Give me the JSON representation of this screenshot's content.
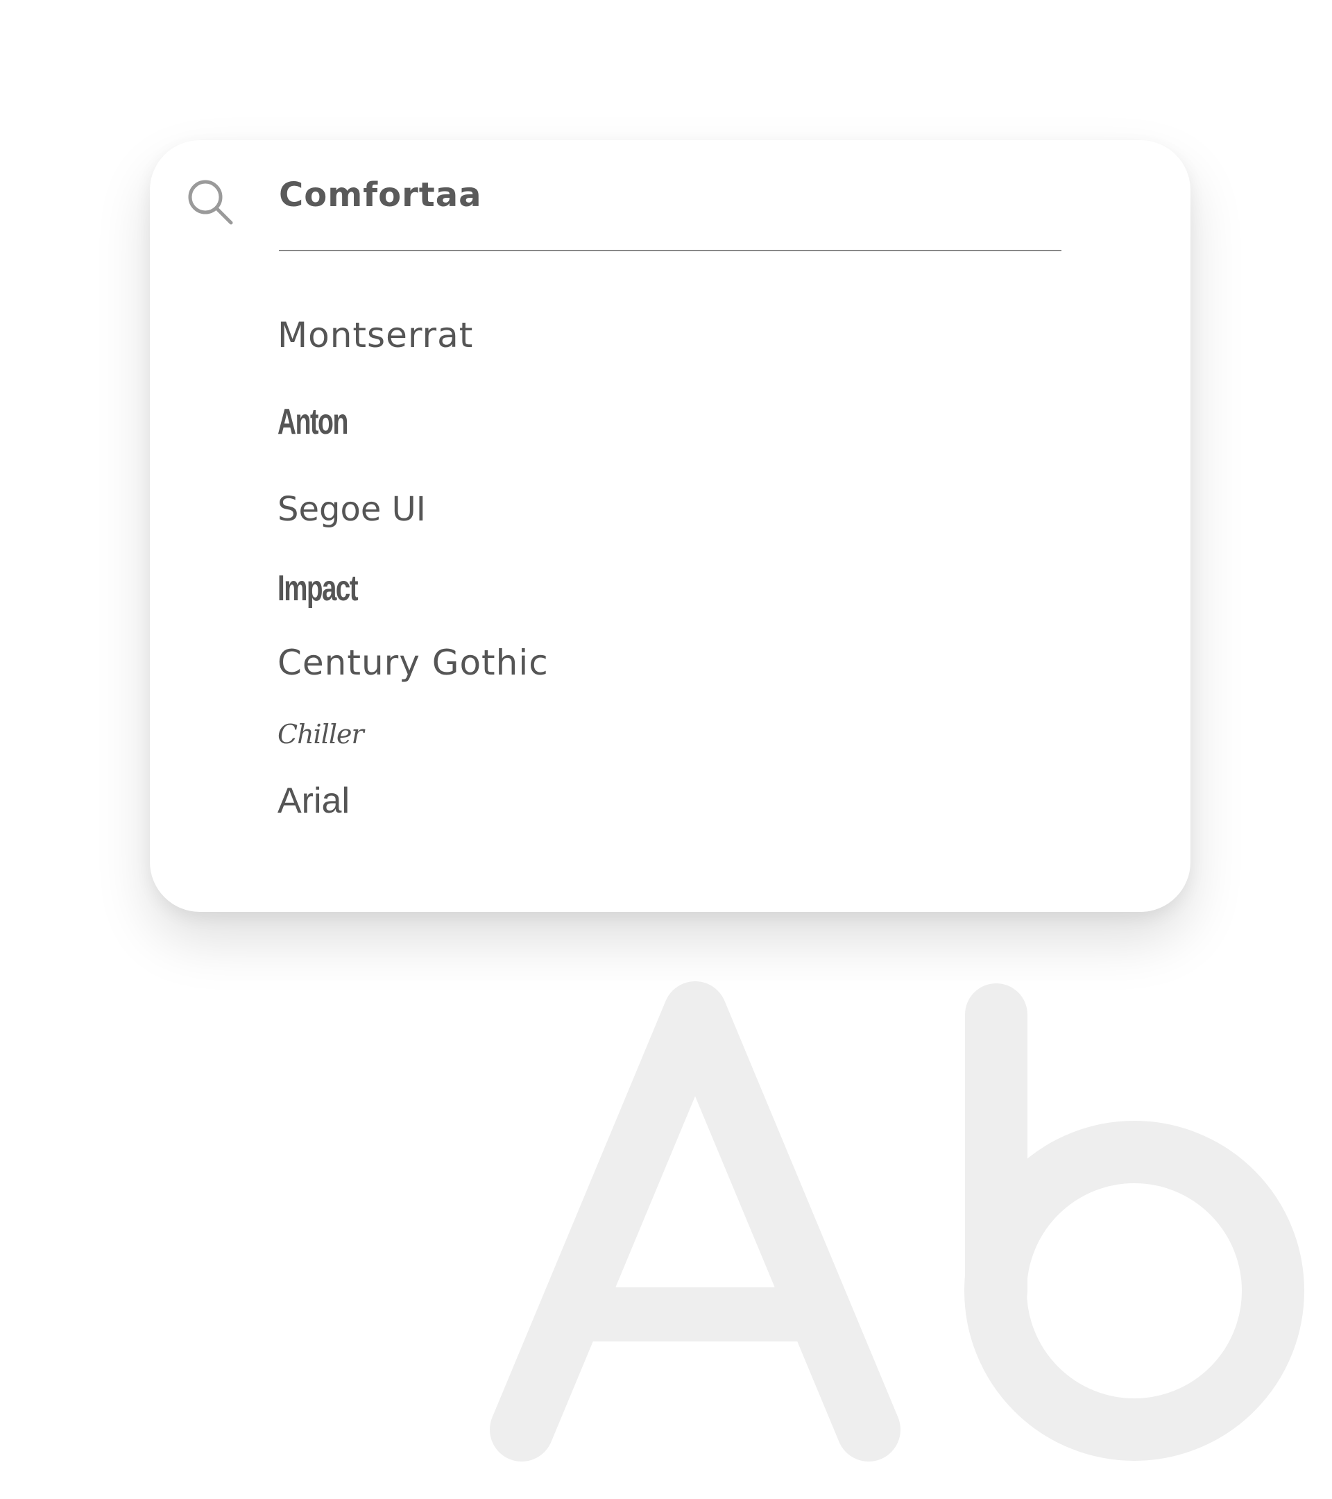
{
  "search": {
    "value": "Comfortaa",
    "icon": "search-icon"
  },
  "font_list": {
    "items": [
      {
        "label": "Montserrat"
      },
      {
        "label": "Anton"
      },
      {
        "label": "Segoe UI"
      },
      {
        "label": "Impact"
      },
      {
        "label": "Century Gothic"
      },
      {
        "label": "Chiller"
      },
      {
        "label": "Arial"
      }
    ]
  },
  "watermark": {
    "text": "Ab",
    "color": "#eeeeee"
  },
  "colors": {
    "text": "#555555",
    "icon": "#9a9a9a",
    "underline": "#8a8a8a",
    "background": "#ffffff"
  }
}
